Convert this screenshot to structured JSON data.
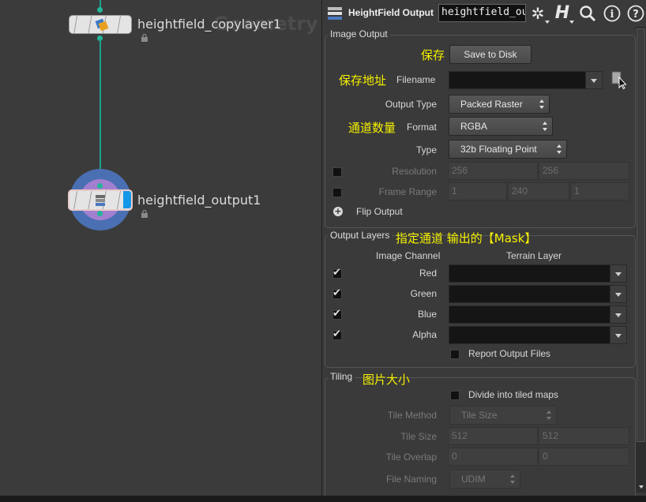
{
  "network": {
    "watermark": "Geometry",
    "nodes": [
      {
        "name": "heightfield_copylayer1"
      },
      {
        "name": "heightfield_output1"
      }
    ]
  },
  "toolbar": {
    "node_type": "HeightField Output",
    "node_name": "heightfield_output1",
    "icons": [
      "heightfield-output-icon",
      "gear-icon",
      "houdini-h-icon",
      "search-icon",
      "info-icon",
      "help-icon"
    ]
  },
  "image_output": {
    "title": "Image Output",
    "save_label": "Save to Disk",
    "filename_label": "Filename",
    "filename_value": "",
    "output_type_label": "Output Type",
    "output_type_value": "Packed Raster",
    "format_label": "Format",
    "format_value": "RGBA",
    "type_label": "Type",
    "type_value": "32b Floating Point",
    "resolution_label": "Resolution",
    "resolution_values": [
      "256",
      "256"
    ],
    "frame_range_label": "Frame Range",
    "frame_range_values": [
      "1",
      "240",
      "1"
    ],
    "flip_label": "Flip Output"
  },
  "output_layers": {
    "title": "Output Layers",
    "col_image": "Image Channel",
    "col_terrain": "Terrain Layer",
    "channels": [
      {
        "label": "Red",
        "checked": true
      },
      {
        "label": "Green",
        "checked": true
      },
      {
        "label": "Blue",
        "checked": true
      },
      {
        "label": "Alpha",
        "checked": true
      }
    ],
    "report_label": "Report Output Files"
  },
  "tiling": {
    "title": "Tiling",
    "divide_label": "Divide into tiled maps",
    "tile_method_label": "Tile Method",
    "tile_method_value": "Tile Size",
    "tile_size_label": "Tile Size",
    "tile_size_values": [
      "512",
      "512"
    ],
    "tile_overlap_label": "Tile Overlap",
    "tile_overlap_values": [
      "0",
      "0"
    ],
    "file_naming_label": "File Naming",
    "file_naming_value": "UDIM"
  },
  "annotations": {
    "save": "保存",
    "save_path": "保存地址",
    "channel_count": "通道数量",
    "layers_note": "指定通道 输出的【Mask】",
    "image_size": "图片大小"
  }
}
